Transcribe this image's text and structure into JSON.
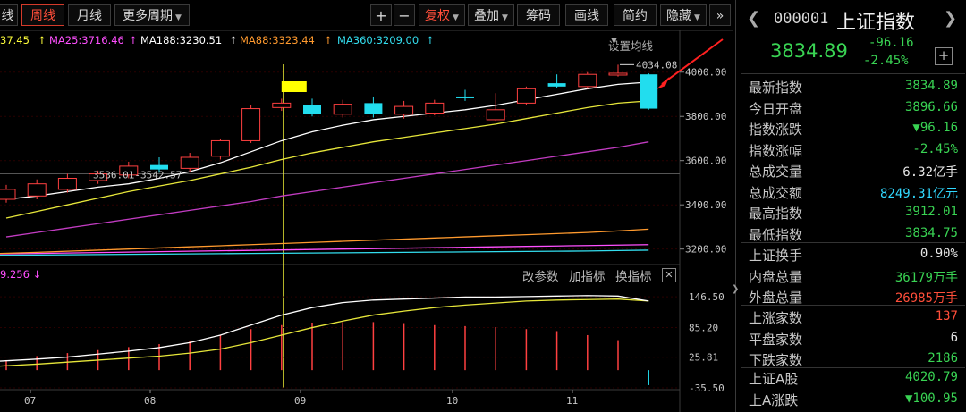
{
  "toolbar": {
    "partial_tab": "线",
    "tab_week": "周线",
    "tab_month": "月线",
    "more_periods": "更多周期",
    "plus": "+",
    "minus": "−",
    "adjust": "复权",
    "overlay": "叠加",
    "chips": "筹码",
    "draw": "画线",
    "simple": "简约",
    "hide": "隐藏",
    "expand": "»"
  },
  "ma": {
    "ma_partial": "37.45",
    "ma25": "MA25:3716.46",
    "ma188": "MA188:3230.51",
    "ma88": "MA88:3323.44",
    "ma360": "MA360:3209.00",
    "settings": "设置均线",
    "colors": {
      "ma25": "#ff4fff",
      "ma188": "#ffffff",
      "ma88": "#ff9a2e",
      "ma360": "#33ddee",
      "ma_partial": "#ffff3a"
    }
  },
  "indicator": {
    "value": "9.256",
    "change_params": "改参数",
    "add_indicator": "加指标",
    "switch_indicator": "换指标"
  },
  "chart_data": {
    "type": "candlestick",
    "y_ticks": [
      "4000.00",
      "3800.00",
      "3600.00",
      "3400.00",
      "3200.00"
    ],
    "y_range": [
      3130,
      4100
    ],
    "x_ticks": [
      "07",
      "08",
      "09",
      "10",
      "11"
    ],
    "annotations": {
      "high": "4034.08",
      "range_label": "3536.01-3542.57"
    },
    "candles": [
      {
        "o": 3425,
        "c": 3470,
        "h": 3490,
        "l": 3410
      },
      {
        "o": 3440,
        "c": 3495,
        "h": 3515,
        "l": 3425
      },
      {
        "o": 3470,
        "c": 3520,
        "h": 3540,
        "l": 3455
      },
      {
        "o": 3510,
        "c": 3540,
        "h": 3555,
        "l": 3495
      },
      {
        "o": 3535,
        "c": 3575,
        "h": 3595,
        "l": 3520
      },
      {
        "o": 3580,
        "c": 3560,
        "h": 3615,
        "l": 3545
      },
      {
        "o": 3565,
        "c": 3615,
        "h": 3635,
        "l": 3550
      },
      {
        "o": 3620,
        "c": 3690,
        "h": 3700,
        "l": 3605
      },
      {
        "o": 3690,
        "c": 3835,
        "h": 3850,
        "l": 3680
      },
      {
        "o": 3840,
        "c": 3860,
        "h": 3880,
        "l": 3825
      },
      {
        "o": 3850,
        "c": 3810,
        "h": 3880,
        "l": 3800
      },
      {
        "o": 3810,
        "c": 3855,
        "h": 3875,
        "l": 3795
      },
      {
        "o": 3860,
        "c": 3810,
        "h": 3890,
        "l": 3795
      },
      {
        "o": 3810,
        "c": 3845,
        "h": 3870,
        "l": 3790
      },
      {
        "o": 3815,
        "c": 3860,
        "h": 3875,
        "l": 3805
      },
      {
        "o": 3890,
        "c": 3885,
        "h": 3920,
        "l": 3870
      },
      {
        "o": 3785,
        "c": 3830,
        "h": 3905,
        "l": 3780
      },
      {
        "o": 3860,
        "c": 3925,
        "h": 3935,
        "l": 3850
      },
      {
        "o": 3950,
        "c": 3935,
        "h": 3990,
        "l": 3930
      },
      {
        "o": 3935,
        "c": 3990,
        "h": 4000,
        "l": 3925
      },
      {
        "o": 3990,
        "c": 3995,
        "h": 4034,
        "l": 3980
      },
      {
        "o": 3990,
        "c": 3835,
        "h": 3995,
        "l": 3830
      }
    ],
    "ma_white": [
      3425,
      3440,
      3460,
      3480,
      3495,
      3520,
      3550,
      3590,
      3640,
      3690,
      3730,
      3760,
      3785,
      3800,
      3815,
      3830,
      3850,
      3875,
      3900,
      3925,
      3945,
      3955
    ],
    "ma_yellow": [
      3340,
      3370,
      3400,
      3430,
      3460,
      3485,
      3510,
      3540,
      3570,
      3605,
      3635,
      3660,
      3685,
      3705,
      3725,
      3745,
      3765,
      3790,
      3815,
      3840,
      3860,
      3870
    ],
    "ma_magenta": [
      3255,
      3275,
      3295,
      3315,
      3335,
      3355,
      3375,
      3395,
      3415,
      3440,
      3460,
      3480,
      3500,
      3520,
      3540,
      3560,
      3580,
      3600,
      3620,
      3640,
      3660,
      3685
    ],
    "ma_orange": [
      3180,
      3185,
      3190,
      3195,
      3200,
      3205,
      3210,
      3215,
      3220,
      3225,
      3230,
      3235,
      3240,
      3245,
      3250,
      3255,
      3260,
      3265,
      3270,
      3275,
      3282,
      3290
    ],
    "ma_purple": [
      3178,
      3180,
      3182,
      3184,
      3186,
      3188,
      3190,
      3192,
      3194,
      3196,
      3198,
      3200,
      3202,
      3204,
      3206,
      3208,
      3210,
      3212,
      3214,
      3216,
      3218,
      3220
    ],
    "ma_cyan": [
      3172,
      3173,
      3174,
      3175,
      3176,
      3177,
      3178,
      3179,
      3180,
      3181,
      3182,
      3183,
      3184,
      3185,
      3186,
      3187,
      3188,
      3189,
      3190,
      3191,
      3193,
      3195
    ],
    "sub_y_ticks": [
      "146.50",
      "85.20",
      "25.81",
      "-35.50"
    ],
    "sub_range": [
      -35.5,
      170
    ],
    "sub_white": [
      18,
      22,
      26,
      32,
      38,
      45,
      55,
      70,
      90,
      110,
      125,
      135,
      140,
      142,
      144,
      146,
      146,
      147,
      148,
      149,
      148,
      138
    ],
    "sub_yellow": [
      8,
      12,
      16,
      20,
      24,
      28,
      34,
      42,
      55,
      70,
      85,
      98,
      110,
      118,
      125,
      130,
      134,
      138,
      140,
      141,
      142,
      138
    ],
    "sub_bars": [
      20,
      28,
      34,
      40,
      46,
      52,
      58,
      70,
      82,
      90,
      95,
      96,
      96,
      94,
      90,
      88,
      86,
      82,
      78,
      70,
      60,
      -30
    ]
  },
  "panel": {
    "code": "000001",
    "name": "上证指数",
    "price": "3834.89",
    "change": "-96.16",
    "change_pct": "-2.45%",
    "add": "+",
    "rows1": [
      {
        "k": "最新指数",
        "v": "3834.89",
        "c": "#39d353"
      },
      {
        "k": "今日开盘",
        "v": "3896.66",
        "c": "#39d353"
      },
      {
        "k": "指数涨跌",
        "v": "▼96.16",
        "c": "#39d353"
      },
      {
        "k": "指数涨幅",
        "v": "-2.45%",
        "c": "#39d353"
      },
      {
        "k": "总成交量",
        "v": "6.32亿手",
        "c": "#e6e6e6"
      },
      {
        "k": "总成交额",
        "v": "8249.31亿元",
        "c": "#31d8ff"
      },
      {
        "k": "最高指数",
        "v": "3912.01",
        "c": "#39d353"
      },
      {
        "k": "最低指数",
        "v": "3834.75",
        "c": "#39d353"
      }
    ],
    "rows2": [
      {
        "k": "上证换手",
        "v": "0.90%",
        "c": "#e6e6e6"
      },
      {
        "k": "内盘总量",
        "v": "36179万手",
        "c": "#39d353"
      },
      {
        "k": "外盘总量",
        "v": "26985万手",
        "c": "#ff4e3a"
      }
    ],
    "rows3": [
      {
        "k": "上涨家数",
        "v": "137",
        "c": "#ff4e3a"
      },
      {
        "k": "平盘家数",
        "v": "6",
        "c": "#e6e6e6"
      },
      {
        "k": "下跌家数",
        "v": "2186",
        "c": "#39d353"
      }
    ],
    "rows4": [
      {
        "k": "上证A股",
        "v": "4020.79",
        "c": "#39d353"
      },
      {
        "k": "上A涨跌",
        "v": "▼100.95",
        "c": "#39d353"
      }
    ]
  }
}
